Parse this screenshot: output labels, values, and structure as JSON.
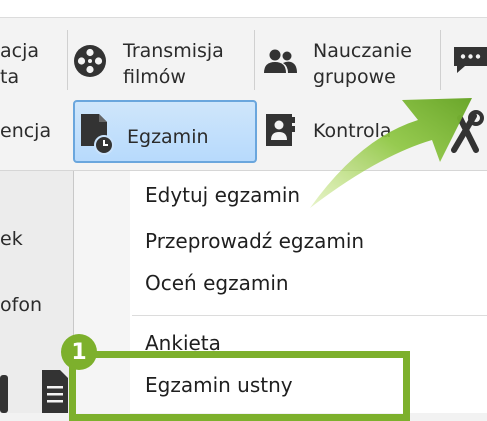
{
  "ribbon": {
    "row1": {
      "left_cut_line1": "acja",
      "left_cut_line2": "ta",
      "transmisja_line1": "Transmisja",
      "transmisja_line2": "filmów",
      "nauczanie_line1": "Nauczanie",
      "nauczanie_line2": "grupowe"
    },
    "row2": {
      "left_cut": "encja",
      "egzamin": "Egzamin",
      "kontrola": "Kontrola"
    }
  },
  "left_panel": {
    "item1": "ek",
    "item2": "ofon"
  },
  "menu": {
    "items": [
      {
        "label": "Edytuj egzamin"
      },
      {
        "label": "Przeprowadź egzamin"
      },
      {
        "label": "Oceń egzamin"
      },
      {
        "label": "Ankieta"
      },
      {
        "label": "Egzamin ustny"
      }
    ]
  },
  "annotation": {
    "badge_number": "1"
  },
  "colors": {
    "accent_green": "#7db02c",
    "selected_blue": "#b7dafc"
  },
  "icons": [
    "film-reel-icon",
    "group-people-icon",
    "chat-icon",
    "exam-document-icon",
    "contact-card-icon",
    "tools-icon",
    "document-icon"
  ]
}
